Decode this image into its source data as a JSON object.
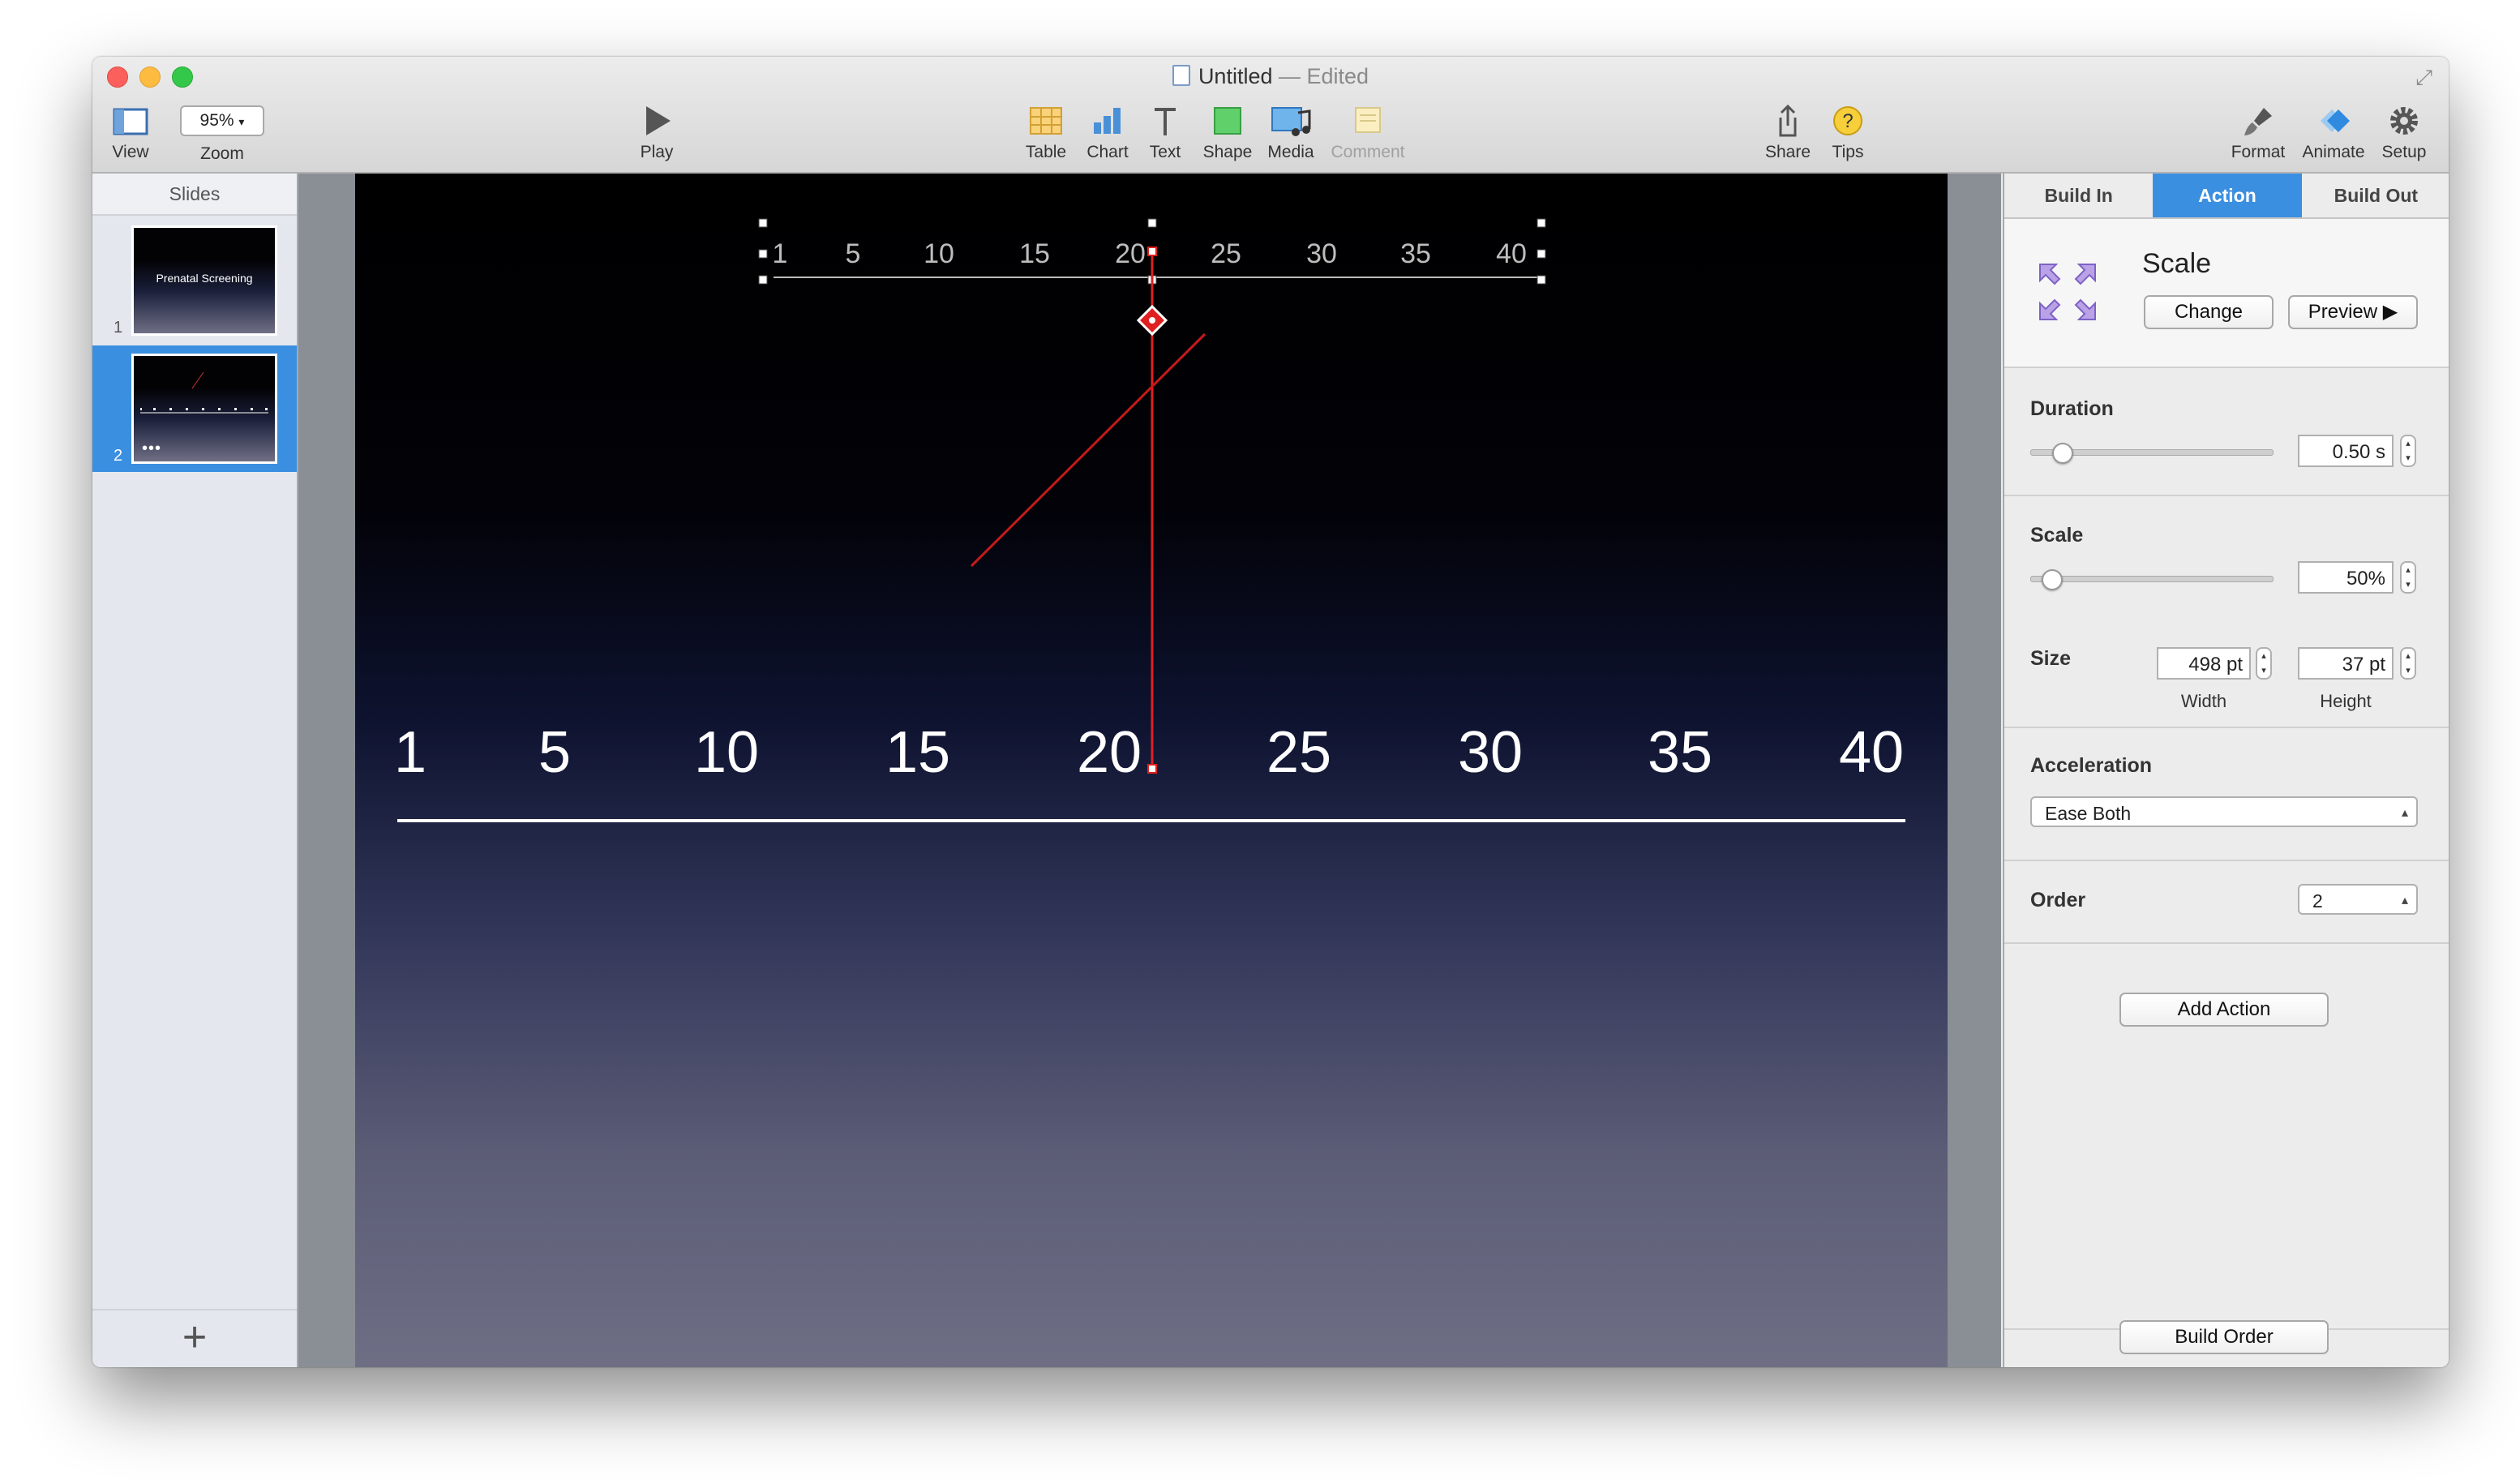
{
  "window": {
    "title": "Untitled",
    "title_suffix": "— Edited"
  },
  "toolbar": {
    "view": "View",
    "zoom_value": "95%",
    "zoom": "Zoom",
    "play": "Play",
    "table": "Table",
    "chart": "Chart",
    "text": "Text",
    "shape": "Shape",
    "media": "Media",
    "comment": "Comment",
    "share": "Share",
    "tips": "Tips",
    "format": "Format",
    "animate": "Animate",
    "setup": "Setup"
  },
  "sidebar": {
    "header": "Slides",
    "slides": [
      {
        "number": "1",
        "title": "Prenatal Screening"
      },
      {
        "number": "2",
        "title": "",
        "dots": "•••"
      }
    ],
    "add": "+"
  },
  "slide": {
    "small_scale_labels": [
      "1",
      "5",
      "10",
      "15",
      "20",
      "25",
      "30",
      "35",
      "40"
    ],
    "large_scale_labels": [
      "1",
      "5",
      "10",
      "15",
      "20",
      "25",
      "30",
      "35",
      "40"
    ]
  },
  "inspector": {
    "tabs": [
      "Build In",
      "Action",
      "Build Out"
    ],
    "active_tab": "Action",
    "effect_name": "Scale",
    "change": "Change",
    "preview": "Preview ▶",
    "duration_label": "Duration",
    "duration_value": "0.50 s",
    "duration_fraction": 0.1,
    "scale_label": "Scale",
    "scale_value": "50%",
    "scale_fraction": 0.05,
    "size_label": "Size",
    "width_value": "498 pt",
    "width_label": "Width",
    "height_value": "37 pt",
    "height_label": "Height",
    "acceleration_label": "Acceleration",
    "acceleration_value": "Ease Both",
    "order_label": "Order",
    "order_value": "2",
    "add_action": "Add Action",
    "build_order": "Build Order"
  }
}
